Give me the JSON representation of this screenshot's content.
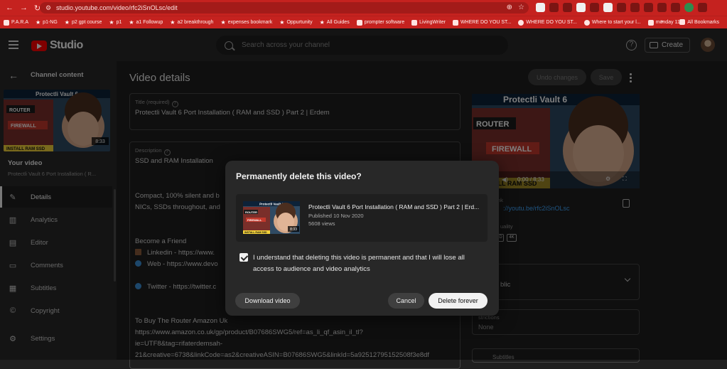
{
  "browser": {
    "url": "studio.youtube.com/video/rfc2iSnOLsc/edit",
    "bookmarks": [
      {
        "label": "P.A.R.A",
        "icon": "folder-icon"
      },
      {
        "label": "p1-NG",
        "icon": "star-icon"
      },
      {
        "label": "p2 gpt course",
        "icon": "star-icon"
      },
      {
        "label": "p1",
        "icon": "star-icon"
      },
      {
        "label": "a1 Followup",
        "icon": "star-icon"
      },
      {
        "label": "a2 breakthrough",
        "icon": "star-icon"
      },
      {
        "label": "expenses bookmark",
        "icon": "star-icon"
      },
      {
        "label": "Oppurtunity",
        "icon": "star-icon"
      },
      {
        "label": "All Guides",
        "icon": "star-icon"
      },
      {
        "label": "prompter software",
        "icon": "folder-icon"
      },
      {
        "label": "LivingWriter",
        "icon": "w-icon"
      },
      {
        "label": "WHERE DO YOU ST...",
        "icon": "app-icon"
      },
      {
        "label": "WHERE DO YOU ST...",
        "icon": "circle-icon"
      },
      {
        "label": "Where to start your l...",
        "icon": "circle-icon"
      },
      {
        "label": "monday 11",
        "icon": "m-icon"
      }
    ],
    "more_bookmarks": "»",
    "all_bookmarks": "All Bookmarks"
  },
  "header": {
    "logo_text": "Studio",
    "search_placeholder": "Search across your channel",
    "create_label": "Create",
    "help_glyph": "?"
  },
  "sidebar": {
    "back_glyph": "←",
    "title": "Channel content",
    "your_video_label": "Your video",
    "your_video_sub": "Protectli Vault 6 Port Installation ( R...",
    "items": [
      {
        "label": "Details",
        "icon": "pencil-icon",
        "glyph": "✎"
      },
      {
        "label": "Analytics",
        "icon": "analytics-icon",
        "glyph": "▥"
      },
      {
        "label": "Editor",
        "icon": "editor-icon",
        "glyph": "▤"
      },
      {
        "label": "Comments",
        "icon": "comments-icon",
        "glyph": "▭"
      },
      {
        "label": "Subtitles",
        "icon": "subtitles-icon",
        "glyph": "▦"
      },
      {
        "label": "Copyright",
        "icon": "copyright-icon",
        "glyph": "©"
      },
      {
        "label": "Settings",
        "icon": "gear-icon",
        "glyph": "⚙"
      }
    ]
  },
  "thumbnail": {
    "top_text": "Protectli Vault 6",
    "router": "ROUTER",
    "firewall": "FIREWALL",
    "bottom_text": "INSTALL RAM SSD",
    "duration": "8:33",
    "partial_bottom_text": "ALL RAM SSD"
  },
  "main": {
    "title": "Video details",
    "undo_label": "Undo changes",
    "save_label": "Save",
    "title_field_label": "Title (required)",
    "title_value": "Protectli Vault 6 Port Installation ( RAM and SSD ) Part 2 | Erdem",
    "description_label": "Description",
    "description_lines": [
      "SSD and RAM Installation",
      "Compact, 100% silent and b",
      "NICs, SSDs throughout, and",
      "Become a Friend",
      "Linkedin - https://www.",
      "Web - https://www.devo",
      "Twitter - https://twitter.c",
      "To Buy The Router Amazon Uk",
      "https://www.amazon.co.uk/gp/product/B07686SWG5/ref=as_li_qf_asin_il_tl?",
      "ie=UTF8&tag=rifaterdemsah-",
      "21&creative=6738&linkCode=as2&creativeASIN=B07686SWG5&linkId=5a92512795152508f3e8df"
    ]
  },
  "right_panel": {
    "time": "0:00 / 8:33",
    "link_label": "nk",
    "link_value": "://youtu.be/rfc2iSnOLsc",
    "quality_label": "uality",
    "quality_badges": [
      "D",
      "4K"
    ],
    "visibility_value": "blic",
    "restrictions_label": "strictions",
    "restrictions_value": "None",
    "subtitles_label": "Subtitles"
  },
  "modal": {
    "title": "Permanently delete this video?",
    "video_title": "Protectli Vault 6 Port Installation ( RAM and SSD ) Part 2 | Erd...",
    "published": "Published 10 Nov 2020",
    "views": "5608 views",
    "confirm_text": "I understand that deleting this video is permanent and that I will lose all access to audience and video analytics",
    "download_label": "Download video",
    "cancel_label": "Cancel",
    "delete_label": "Delete forever"
  },
  "colors": {
    "browser_red": "#c5221f",
    "studio_bg": "#1f1f1f",
    "panel_bg": "#282828",
    "link_blue": "#3ea6ff",
    "youtube_red": "#ff0000"
  }
}
